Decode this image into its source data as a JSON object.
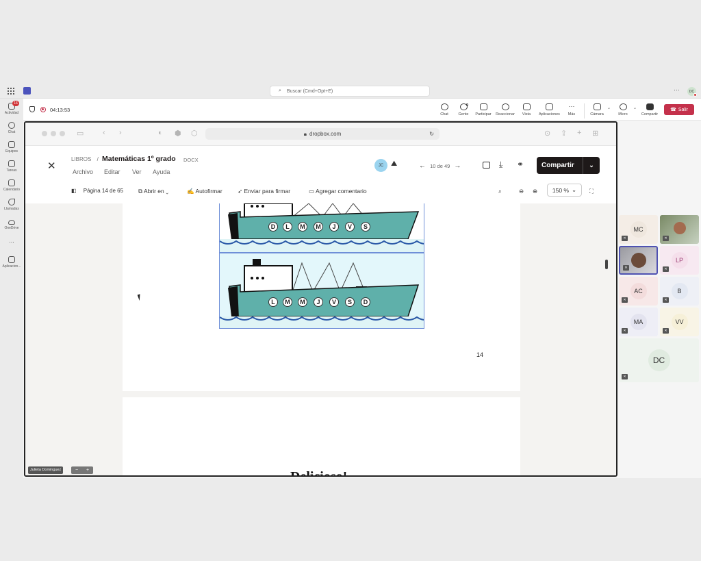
{
  "teams": {
    "search_placeholder": "Buscar (Cmd+Opt+E)",
    "user_initials": "DC",
    "rail": [
      {
        "label": "Actividad",
        "icon": "bell-icon",
        "badge": "16"
      },
      {
        "label": "Chat",
        "icon": "chat-icon"
      },
      {
        "label": "Equipos",
        "icon": "teams-icon"
      },
      {
        "label": "Tareas",
        "icon": "tasks-icon"
      },
      {
        "label": "Calendario",
        "icon": "calendar-icon"
      },
      {
        "label": "Llamadas",
        "icon": "phone-icon"
      },
      {
        "label": "OneDrive",
        "icon": "cloud-icon"
      },
      {
        "label": "...",
        "icon": "more-icon"
      },
      {
        "label": "Aplicacion...",
        "icon": "add-app-icon"
      }
    ],
    "meeting": {
      "timer": "04:13:53",
      "controls": [
        {
          "label": "Chat",
          "icon": "chat-icon"
        },
        {
          "label": "Gente",
          "icon": "people-icon",
          "count": "9"
        },
        {
          "label": "Participar",
          "icon": "hand-icon"
        },
        {
          "label": "Reaccionar",
          "icon": "smile-icon"
        },
        {
          "label": "Vista",
          "icon": "grid-icon"
        },
        {
          "label": "Aplicaciones",
          "icon": "add-icon"
        },
        {
          "label": "Más",
          "icon": "more-icon"
        },
        {
          "label": "Cámara",
          "icon": "camera-off-icon"
        },
        {
          "label": "Micro",
          "icon": "mic-off-icon"
        },
        {
          "label": "Compartir",
          "icon": "share-icon"
        }
      ],
      "leave_label": "Salir"
    },
    "participants": [
      {
        "initials": "MC",
        "color": "#efe7de"
      },
      {
        "initials": "",
        "photo": true
      },
      {
        "initials": "",
        "photo": true,
        "active": true
      },
      {
        "initials": "LP",
        "color": "#f5dfeb"
      },
      {
        "initials": "AC",
        "color": "#f3dcdc"
      },
      {
        "initials": "B",
        "color": "#e3e8f2"
      },
      {
        "initials": "MA",
        "color": "#e3e3ef"
      },
      {
        "initials": "VV",
        "color": "#f6f0d8"
      },
      {
        "initials": "DC",
        "color": "#e6efe6"
      }
    ],
    "presenter_name": "Julieta Dominguez",
    "presenter_zoom": [
      "−",
      "+"
    ]
  },
  "browser": {
    "url": "dropbox.com"
  },
  "dropbox": {
    "breadcrumb": "LIBROS",
    "separator": "/",
    "title": "Matemáticas 1º grado",
    "ext": "DOCX",
    "menu": [
      "Archivo",
      "Editar",
      "Ver",
      "Ayuda"
    ],
    "collaborator": "JC",
    "file_position": "10 de 49",
    "share_label": "Compartir",
    "page_indicator": "Página 14 de 65",
    "tools": [
      "Abrir en",
      "Autofirmar",
      "Enviar para firmar",
      "Agregar comentario"
    ],
    "zoom": "150 %"
  },
  "document": {
    "ship1_letters": [
      "D",
      "L",
      "M",
      "M",
      "J",
      "V",
      "S"
    ],
    "ship2_letters": [
      "L",
      "M",
      "M",
      "J",
      "V",
      "S",
      "D"
    ],
    "page_number": "14",
    "next_heading": "Delicioso!"
  }
}
